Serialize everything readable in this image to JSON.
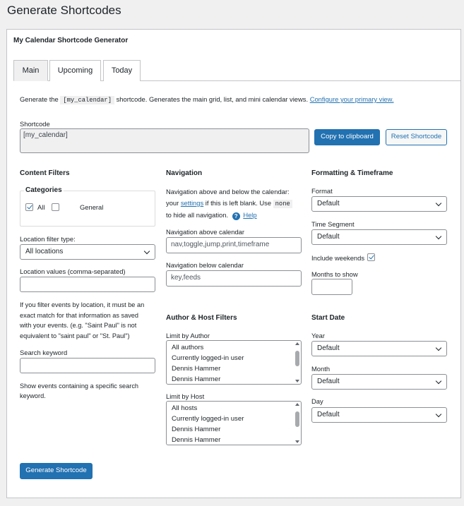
{
  "page": {
    "title": "Generate Shortcodes"
  },
  "panel": {
    "title": "My Calendar Shortcode Generator"
  },
  "tabs": [
    {
      "label": "Main",
      "active": true
    },
    {
      "label": "Upcoming",
      "active": false
    },
    {
      "label": "Today",
      "active": false
    }
  ],
  "intro": {
    "pre": "Generate the",
    "code": "[my_calendar]",
    "post": "shortcode. Generates the main grid, list, and mini calendar views.",
    "link": "Configure your primary view."
  },
  "shortcode": {
    "label": "Shortcode",
    "value": "[my_calendar]",
    "copy_button": "Copy to clipboard",
    "reset_button": "Reset Shortcode"
  },
  "content_filters": {
    "heading": "Content Filters",
    "categories": {
      "legend": "Categories",
      "options": [
        {
          "label": "All",
          "checked": true
        },
        {
          "label": "General",
          "checked": false
        }
      ]
    },
    "location_type": {
      "label": "Location filter type:",
      "value": "All locations"
    },
    "location_values": {
      "label": "Location values (comma-separated)",
      "value": ""
    },
    "location_help": [
      "If you filter events by location, it must be an",
      "exact match for that information as saved",
      "with your events. (e.g. \"Saint Paul\" is not",
      "equivalent to \"saint paul\" or \"St. Paul\")"
    ],
    "search": {
      "label": "Search keyword",
      "value": ""
    },
    "search_help": [
      "Show events containing a specific search",
      "keyword."
    ]
  },
  "navigation": {
    "heading": "Navigation",
    "desc_line1": "Navigation above and below the calendar:",
    "desc_pre": "your",
    "desc_link": "settings",
    "desc_mid": "if this is left blank. Use",
    "desc_code": "none",
    "desc_line3": "to hide all navigation.",
    "help_label": "Help",
    "above": {
      "label": "Navigation above calendar",
      "placeholder": "nav,toggle,jump,print,timeframe"
    },
    "below": {
      "label": "Navigation below calendar",
      "placeholder": "key,feeds"
    }
  },
  "author_host": {
    "heading": "Author & Host Filters",
    "author": {
      "label": "Limit by Author",
      "options": [
        "All authors",
        "Currently logged-in user",
        "Dennis Hammer",
        "Dennis Hammer"
      ]
    },
    "host": {
      "label": "Limit by Host",
      "options": [
        "All hosts",
        "Currently logged-in user",
        "Dennis Hammer",
        "Dennis Hammer"
      ]
    }
  },
  "formatting": {
    "heading": "Formatting & Timeframe",
    "format": {
      "label": "Format",
      "value": "Default"
    },
    "segment": {
      "label": "Time Segment",
      "value": "Default"
    },
    "weekends": {
      "label": "Include weekends",
      "checked": true
    },
    "months": {
      "label": "Months to show",
      "value": ""
    }
  },
  "start_date": {
    "heading": "Start Date",
    "year": {
      "label": "Year",
      "value": "Default"
    },
    "month": {
      "label": "Month",
      "value": "Default"
    },
    "day": {
      "label": "Day",
      "value": "Default"
    }
  },
  "generate_button": "Generate Shortcode",
  "colors": {
    "accent": "#2271b1",
    "background": "#f0f0f1",
    "border": "#c3c4c7"
  }
}
